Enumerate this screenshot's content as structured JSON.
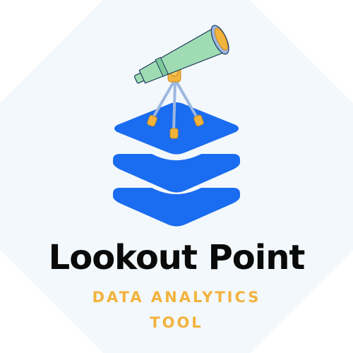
{
  "logo": {
    "name": "Lookout Point",
    "tagline_line1": "DATA ANALYTICS",
    "tagline_line2": "TOOL",
    "icon": "telescope-on-stacked-layers-icon"
  },
  "colors": {
    "background": "#f3f8fc",
    "primary_blue": "#1a6cf0",
    "accent_yellow": "#f2b33d",
    "telescope_green": "#9fdcb4",
    "tripod_blue": "#9bb8e0",
    "text_dark": "#0a0a0a"
  }
}
